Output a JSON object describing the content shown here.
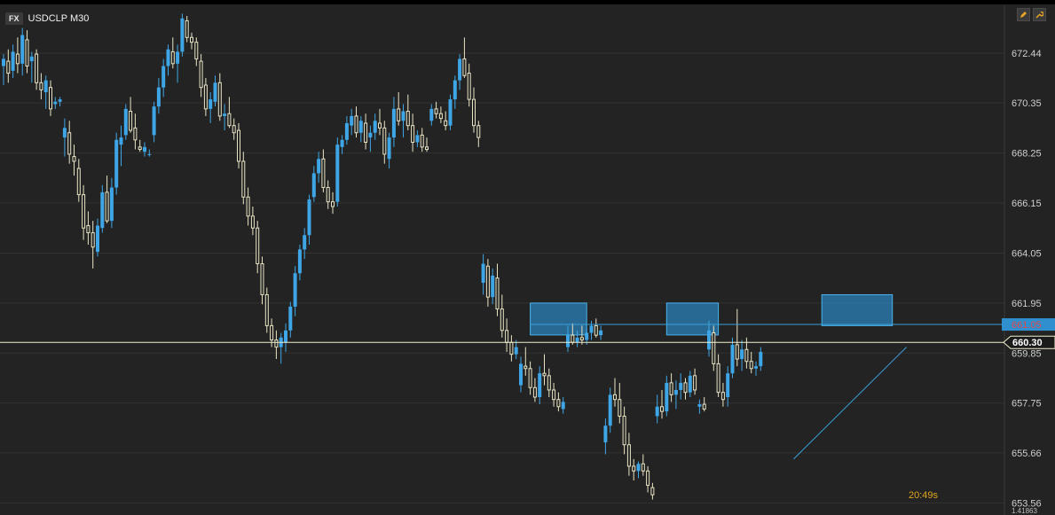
{
  "header": {
    "fx_badge": "FX",
    "symbol": "USDCLP M30"
  },
  "timer": "20:49s",
  "price_axis": {
    "labels": [
      "672.44",
      "670.35",
      "668.25",
      "666.15",
      "664.05",
      "661.95",
      "659.85",
      "657.75",
      "655.66",
      "653.56"
    ],
    "current_price": "660.30",
    "level_price": "661.05",
    "bottom_value": "1.41863"
  },
  "colors": {
    "background": "#232323",
    "grid": "#333333",
    "bull": "#3ea6e6",
    "bear": "#e9e4c4",
    "zone_fill": "#2b8fd0",
    "current_line": "#f1efcf",
    "level_line": "#3a9fdc",
    "timer": "#e0a61f"
  },
  "icons": {
    "edit": "pencil-icon",
    "settings": "wrench-icon"
  },
  "chart_data": {
    "type": "candlestick",
    "title": "USDCLP M30",
    "ylim": [
      653.2,
      674.3
    ],
    "yticks": [
      672.44,
      670.35,
      668.25,
      666.15,
      664.05,
      661.95,
      659.85,
      657.75,
      655.66,
      653.56
    ],
    "current_price": 660.3,
    "level_price": 661.05,
    "grid": true,
    "candles": [
      [
        671.9,
        672.4,
        671.1,
        672.2
      ],
      [
        672.1,
        672.6,
        671.2,
        671.6
      ],
      [
        671.7,
        672.8,
        671.4,
        672.5
      ],
      [
        672.4,
        673.1,
        671.6,
        672.0
      ],
      [
        672.0,
        673.5,
        671.5,
        673.2
      ],
      [
        673.0,
        673.4,
        671.6,
        671.9
      ],
      [
        672.1,
        672.5,
        671.2,
        672.3
      ],
      [
        672.4,
        672.6,
        670.9,
        671.2
      ],
      [
        671.2,
        671.6,
        670.5,
        670.9
      ],
      [
        670.8,
        671.5,
        670.1,
        671.3
      ],
      [
        671.0,
        671.3,
        669.8,
        670.1
      ],
      [
        670.3,
        670.6,
        670.1,
        670.4
      ],
      [
        670.4,
        670.6,
        670.2,
        670.5
      ],
      [
        668.9,
        669.7,
        668.1,
        669.3
      ],
      [
        669.1,
        669.6,
        667.8,
        668.2
      ],
      [
        668.1,
        668.6,
        667.3,
        667.9
      ],
      [
        667.6,
        668.0,
        666.2,
        666.5
      ],
      [
        666.5,
        666.9,
        664.6,
        665.1
      ],
      [
        665.2,
        665.8,
        664.4,
        664.9
      ],
      [
        664.9,
        665.4,
        663.4,
        664.3
      ],
      [
        664.1,
        665.5,
        663.9,
        665.2
      ],
      [
        665.1,
        666.9,
        664.9,
        666.6
      ],
      [
        666.6,
        667.3,
        665.3,
        665.4
      ],
      [
        665.4,
        667.2,
        665.1,
        666.8
      ],
      [
        666.8,
        669.1,
        666.5,
        668.8
      ],
      [
        668.6,
        669.4,
        667.7,
        668.9
      ],
      [
        669.0,
        670.3,
        668.8,
        670.1
      ],
      [
        670.0,
        670.6,
        669.1,
        669.2
      ],
      [
        669.3,
        669.9,
        668.4,
        668.8
      ],
      [
        668.5,
        668.8,
        668.3,
        668.4
      ],
      [
        668.3,
        668.7,
        668.1,
        668.5
      ],
      [
        668.2,
        668.4,
        668.1,
        668.2
      ],
      [
        669.0,
        670.4,
        668.7,
        670.2
      ],
      [
        670.2,
        671.4,
        669.9,
        671.0
      ],
      [
        671.0,
        672.2,
        670.6,
        671.9
      ],
      [
        671.9,
        672.8,
        671.5,
        672.6
      ],
      [
        672.5,
        673.1,
        671.8,
        672.0
      ],
      [
        672.0,
        672.8,
        671.2,
        672.5
      ],
      [
        672.5,
        674.1,
        672.3,
        673.9
      ],
      [
        673.8,
        674.0,
        672.9,
        673.1
      ],
      [
        673.1,
        673.3,
        672.6,
        672.9
      ],
      [
        672.9,
        673.1,
        671.9,
        672.2
      ],
      [
        672.1,
        672.4,
        670.6,
        671.0
      ],
      [
        671.1,
        671.4,
        669.8,
        670.1
      ],
      [
        670.1,
        670.8,
        669.5,
        670.5
      ],
      [
        670.4,
        671.5,
        670.2,
        671.2
      ],
      [
        671.2,
        671.6,
        669.6,
        669.8
      ],
      [
        669.8,
        670.3,
        669.2,
        669.9
      ],
      [
        669.9,
        670.6,
        669.3,
        669.4
      ],
      [
        669.4,
        669.7,
        668.8,
        669.1
      ],
      [
        669.2,
        669.5,
        667.6,
        667.9
      ],
      [
        667.9,
        668.3,
        666.1,
        666.4
      ],
      [
        666.4,
        666.8,
        665.2,
        665.6
      ],
      [
        665.6,
        666.0,
        664.8,
        665.1
      ],
      [
        665.1,
        665.4,
        663.2,
        663.6
      ],
      [
        663.6,
        663.9,
        661.9,
        662.3
      ],
      [
        662.3,
        662.6,
        660.7,
        661.0
      ],
      [
        661.0,
        661.3,
        660.1,
        660.4
      ],
      [
        660.4,
        660.8,
        659.6,
        660.1
      ],
      [
        660.1,
        660.7,
        659.4,
        660.5
      ],
      [
        660.3,
        661.1,
        659.9,
        660.8
      ],
      [
        660.8,
        662.0,
        660.5,
        661.8
      ],
      [
        661.8,
        663.5,
        661.4,
        663.2
      ],
      [
        663.2,
        664.4,
        662.9,
        664.2
      ],
      [
        664.2,
        665.1,
        663.8,
        664.8
      ],
      [
        664.8,
        666.5,
        664.4,
        666.3
      ],
      [
        666.4,
        667.7,
        666.2,
        667.4
      ],
      [
        667.4,
        668.3,
        667.0,
        668.0
      ],
      [
        668.0,
        668.4,
        666.6,
        666.8
      ],
      [
        666.8,
        667.1,
        665.9,
        666.2
      ],
      [
        666.2,
        666.6,
        665.7,
        666.0
      ],
      [
        666.2,
        668.9,
        666.0,
        668.6
      ],
      [
        668.5,
        669.0,
        668.2,
        668.8
      ],
      [
        668.8,
        669.8,
        668.6,
        669.5
      ],
      [
        669.4,
        670.1,
        669.0,
        669.8
      ],
      [
        669.8,
        670.2,
        668.9,
        669.1
      ],
      [
        669.1,
        669.8,
        668.7,
        669.6
      ],
      [
        669.5,
        669.9,
        668.4,
        668.7
      ],
      [
        668.9,
        669.4,
        668.3,
        669.1
      ],
      [
        669.1,
        669.9,
        668.8,
        669.6
      ],
      [
        669.5,
        670.1,
        669.0,
        669.3
      ],
      [
        669.3,
        669.6,
        667.8,
        668.2
      ],
      [
        668.0,
        669.1,
        667.6,
        668.9
      ],
      [
        668.9,
        670.6,
        668.5,
        670.1
      ],
      [
        670.1,
        670.8,
        669.4,
        669.6
      ],
      [
        669.6,
        670.3,
        668.9,
        670.0
      ],
      [
        670.0,
        670.7,
        669.2,
        669.4
      ],
      [
        669.4,
        669.9,
        668.3,
        668.7
      ],
      [
        668.7,
        669.2,
        668.5,
        669.0
      ],
      [
        669.0,
        669.3,
        668.3,
        668.5
      ],
      [
        668.5,
        668.9,
        668.3,
        668.4
      ],
      [
        669.6,
        670.3,
        669.4,
        670.1
      ],
      [
        670.1,
        670.4,
        669.7,
        669.9
      ],
      [
        669.9,
        670.2,
        669.5,
        669.7
      ],
      [
        669.6,
        670.0,
        669.2,
        669.4
      ],
      [
        669.4,
        670.7,
        669.2,
        670.5
      ],
      [
        670.5,
        671.5,
        670.1,
        671.3
      ],
      [
        671.3,
        672.4,
        670.9,
        672.2
      ],
      [
        672.2,
        673.1,
        671.4,
        671.5
      ],
      [
        671.6,
        672.0,
        670.2,
        670.5
      ],
      [
        670.5,
        671.0,
        669.1,
        669.4
      ],
      [
        669.4,
        669.6,
        668.5,
        668.9
      ],
      [
        662.8,
        664.0,
        662.3,
        663.6
      ],
      [
        663.5,
        663.8,
        661.8,
        662.2
      ],
      [
        662.2,
        663.4,
        661.9,
        663.1
      ],
      [
        663.0,
        663.6,
        661.4,
        661.7
      ],
      [
        661.7,
        662.3,
        660.5,
        660.8
      ],
      [
        660.8,
        661.3,
        659.9,
        660.3
      ],
      [
        660.3,
        660.6,
        659.5,
        659.8
      ],
      [
        659.8,
        660.4,
        659.6,
        660.1
      ],
      [
        658.5,
        659.7,
        658.2,
        659.4
      ],
      [
        659.3,
        660.1,
        658.9,
        659.2
      ],
      [
        659.2,
        659.5,
        658.1,
        658.4
      ],
      [
        658.4,
        658.8,
        657.8,
        658.0
      ],
      [
        658.0,
        659.3,
        657.7,
        659.0
      ],
      [
        659.0,
        659.8,
        658.5,
        658.9
      ],
      [
        658.9,
        659.2,
        658.0,
        658.3
      ],
      [
        658.3,
        658.6,
        657.6,
        657.9
      ],
      [
        657.9,
        658.2,
        657.4,
        657.6
      ],
      [
        657.5,
        658.0,
        657.3,
        657.8
      ],
      [
        660.1,
        661.0,
        659.9,
        660.6
      ],
      [
        660.6,
        661.1,
        660.2,
        660.3
      ],
      [
        660.3,
        660.8,
        660.1,
        660.5
      ],
      [
        660.5,
        661.0,
        660.2,
        660.4
      ],
      [
        660.4,
        660.9,
        660.2,
        660.7
      ],
      [
        660.7,
        661.2,
        660.4,
        661.0
      ],
      [
        661.0,
        661.3,
        660.5,
        660.6
      ],
      [
        660.6,
        661.0,
        660.4,
        660.8
      ],
      [
        656.1,
        657.1,
        655.6,
        656.8
      ],
      [
        656.8,
        658.4,
        656.5,
        658.1
      ],
      [
        658.1,
        658.8,
        657.6,
        657.9
      ],
      [
        657.9,
        658.6,
        656.9,
        657.2
      ],
      [
        657.2,
        657.6,
        655.6,
        656.0
      ],
      [
        656.0,
        656.5,
        654.7,
        655.1
      ],
      [
        655.1,
        655.4,
        654.5,
        654.9
      ],
      [
        654.9,
        655.3,
        654.6,
        655.2
      ],
      [
        655.2,
        655.6,
        654.7,
        654.9
      ],
      [
        654.9,
        655.1,
        654.0,
        654.3
      ],
      [
        654.2,
        654.4,
        653.7,
        653.9
      ],
      [
        657.2,
        658.1,
        656.9,
        657.6
      ],
      [
        657.6,
        658.3,
        657.1,
        657.4
      ],
      [
        657.4,
        658.9,
        657.2,
        658.6
      ],
      [
        658.6,
        659.0,
        657.8,
        658.1
      ],
      [
        658.1,
        658.7,
        657.5,
        658.3
      ],
      [
        658.3,
        659.0,
        657.9,
        658.6
      ],
      [
        658.6,
        658.8,
        657.9,
        658.2
      ],
      [
        658.2,
        659.1,
        658.0,
        658.9
      ],
      [
        658.9,
        659.2,
        658.1,
        658.3
      ],
      [
        657.6,
        657.9,
        657.3,
        657.7
      ],
      [
        657.7,
        658.0,
        657.4,
        657.5
      ],
      [
        660.0,
        661.2,
        659.7,
        660.8
      ],
      [
        660.7,
        661.0,
        659.1,
        659.4
      ],
      [
        659.4,
        659.8,
        658.0,
        658.2
      ],
      [
        658.2,
        658.6,
        657.6,
        657.9
      ],
      [
        658.0,
        659.3,
        657.6,
        659.0
      ],
      [
        659.0,
        660.5,
        658.8,
        660.2
      ],
      [
        660.2,
        661.7,
        659.3,
        659.6
      ],
      [
        659.6,
        660.4,
        659.1,
        660.0
      ],
      [
        660.0,
        660.5,
        659.2,
        659.5
      ],
      [
        659.5,
        659.9,
        659.0,
        659.2
      ],
      [
        659.2,
        659.5,
        658.9,
        659.3
      ],
      [
        659.3,
        660.1,
        659.1,
        659.9
      ]
    ],
    "zones": [
      {
        "x_from_index": 112,
        "x_to_index": 124,
        "y_top": 661.95,
        "y_bottom": 660.61
      },
      {
        "x_from_index": 141,
        "x_to_index": 152,
        "y_top": 661.95,
        "y_bottom": 660.61
      },
      {
        "x_from_index": 174,
        "x_to_index": 189,
        "y_top": 662.3,
        "y_bottom": 661.0
      }
    ],
    "trendline": {
      "from": {
        "index": 168,
        "price": 655.4
      },
      "to": {
        "index": 192,
        "price": 660.1
      }
    }
  }
}
